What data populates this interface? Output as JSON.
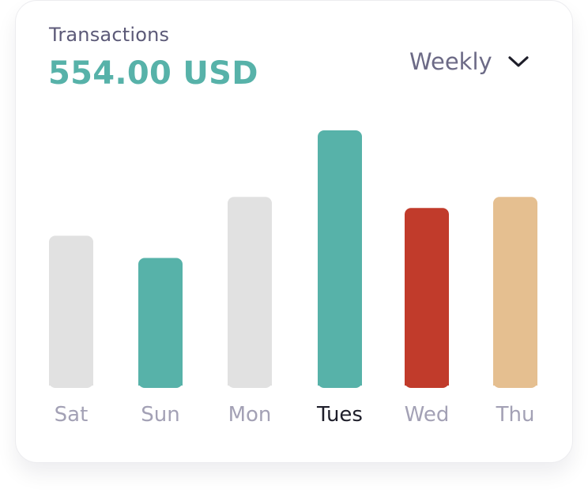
{
  "header": {
    "title": "Transactions",
    "amount": "554.00 USD"
  },
  "period_selector": {
    "selected": "Weekly",
    "icon": "chevron-down-icon"
  },
  "colors": {
    "accent_teal": "#57b2a9",
    "accent_red": "#c13b2b",
    "accent_tan": "#e5bf90",
    "neutral_gray": "#e1e1e1",
    "label_muted": "#a3a1b5",
    "label_active": "#1e1e2a"
  },
  "chart_data": {
    "type": "bar",
    "title": "",
    "xlabel": "",
    "ylabel": "",
    "categories": [
      "Sat",
      "Sun",
      "Mon",
      "Tues",
      "Wed",
      "Thu"
    ],
    "values": [
      54,
      46,
      68,
      92,
      64,
      68
    ],
    "bar_colors": [
      "#e1e1e1",
      "#57b2a9",
      "#e1e1e1",
      "#57b2a9",
      "#c13b2b",
      "#e5bf90"
    ],
    "active_category": "Tues",
    "ylim": [
      0,
      100
    ],
    "grid": false,
    "legend": "none"
  }
}
